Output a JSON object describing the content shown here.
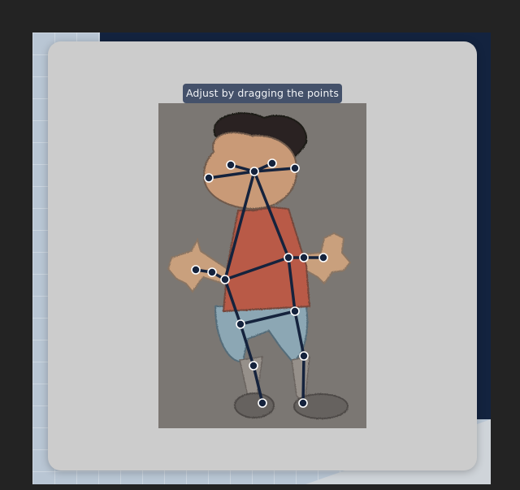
{
  "tooltip": {
    "text": "Adjust by dragging the points"
  },
  "colors": {
    "skeleton": "#15233d",
    "joint_fill": "#15233d",
    "joint_ring": "#ffffff",
    "paper": "#7b7773",
    "tooltip_bg": "#44516a",
    "modal_bg": "#cccccc"
  },
  "skeleton": {
    "joints": [
      "nose",
      "left-eye",
      "right-eye",
      "left-ear",
      "right-ear",
      "left-shoulder",
      "left-elbow",
      "left-wrist",
      "right-shoulder",
      "right-elbow",
      "right-wrist",
      "left-hip",
      "left-knee",
      "left-ankle",
      "right-hip",
      "right-knee",
      "right-ankle"
    ]
  }
}
